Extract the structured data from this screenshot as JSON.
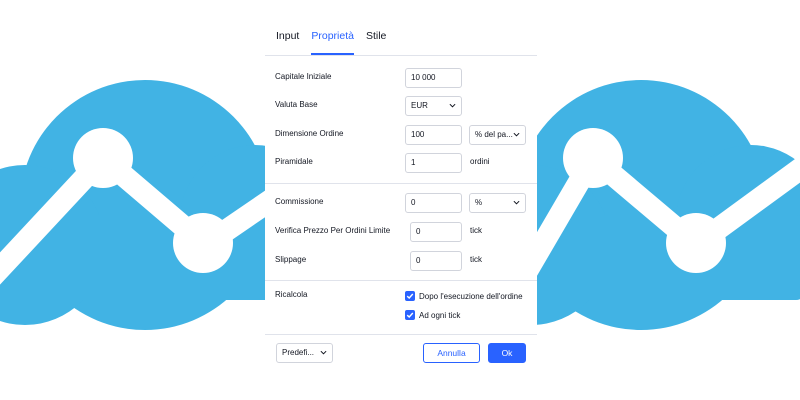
{
  "colors": {
    "accent": "#2962ff",
    "logo": "#41b3e4",
    "border": "#d1d4dc",
    "divider": "#e0e3eb"
  },
  "tabs": [
    {
      "label": "Input",
      "active": false
    },
    {
      "label": "Proprietà",
      "active": true
    },
    {
      "label": "Stile",
      "active": false
    }
  ],
  "fields": {
    "initial_capital": {
      "label": "Capitale Iniziale",
      "value": "10 000"
    },
    "base_currency": {
      "label": "Valuta Base",
      "value": "EUR"
    },
    "order_size": {
      "label": "Dimensione Ordine",
      "value": "100",
      "unit_select": "% del pa..."
    },
    "pyramiding": {
      "label": "Piramidale",
      "value": "1",
      "unit": "ordini"
    },
    "commission": {
      "label": "Commissione",
      "value": "0",
      "unit_select": "%"
    },
    "verify_price": {
      "label": "Verifica Prezzo Per Ordini Limite",
      "value": "0",
      "unit": "tick"
    },
    "slippage": {
      "label": "Slippage",
      "value": "0",
      "unit": "tick"
    }
  },
  "recalc": {
    "label": "Ricalcola",
    "options": [
      {
        "label": "Dopo l'esecuzione dell'ordine",
        "checked": true
      },
      {
        "label": "Ad ogni tick",
        "checked": true
      }
    ]
  },
  "footer": {
    "defaults_label": "Predefi...",
    "cancel_label": "Annulla",
    "ok_label": "Ok"
  },
  "icons": {
    "background_logo": "cloud-chart-logo-icon",
    "dropdown": "chevron-down-icon",
    "checkbox": "checkmark-icon"
  }
}
